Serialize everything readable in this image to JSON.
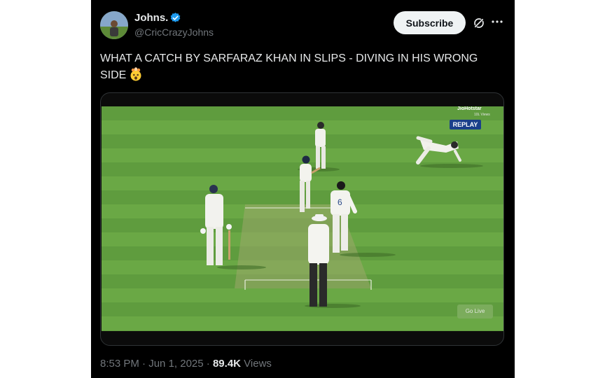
{
  "author": {
    "name": "Johns.",
    "handle": "@CricCrazyJohns"
  },
  "actions": {
    "subscribe_label": "Subscribe",
    "grok_icon": "grok-icon",
    "more_icon": "more-icon"
  },
  "tweet": {
    "text": "WHAT A CATCH BY SARFARAZ KHAN IN SLIPS - DIVING IN HIS WRONG SIDE",
    "emoji": "exploding-head-emoji"
  },
  "video": {
    "broadcaster": "JioHotstar",
    "views_overlay": "10L Views",
    "replay_label": "REPLAY",
    "go_live_label": "Go Live",
    "player_number": "6"
  },
  "meta": {
    "time": "8:53 PM",
    "separator": "·",
    "date": "Jun 1, 2025",
    "views_count": "89.4K",
    "views_label": "Views"
  },
  "colors": {
    "background": "#000000",
    "text_primary": "#e7e9ea",
    "text_secondary": "#71767b",
    "verified_blue": "#1d9bf0",
    "pitch_green": "#5e9a3c",
    "replay_blue": "#1a3f8a"
  }
}
